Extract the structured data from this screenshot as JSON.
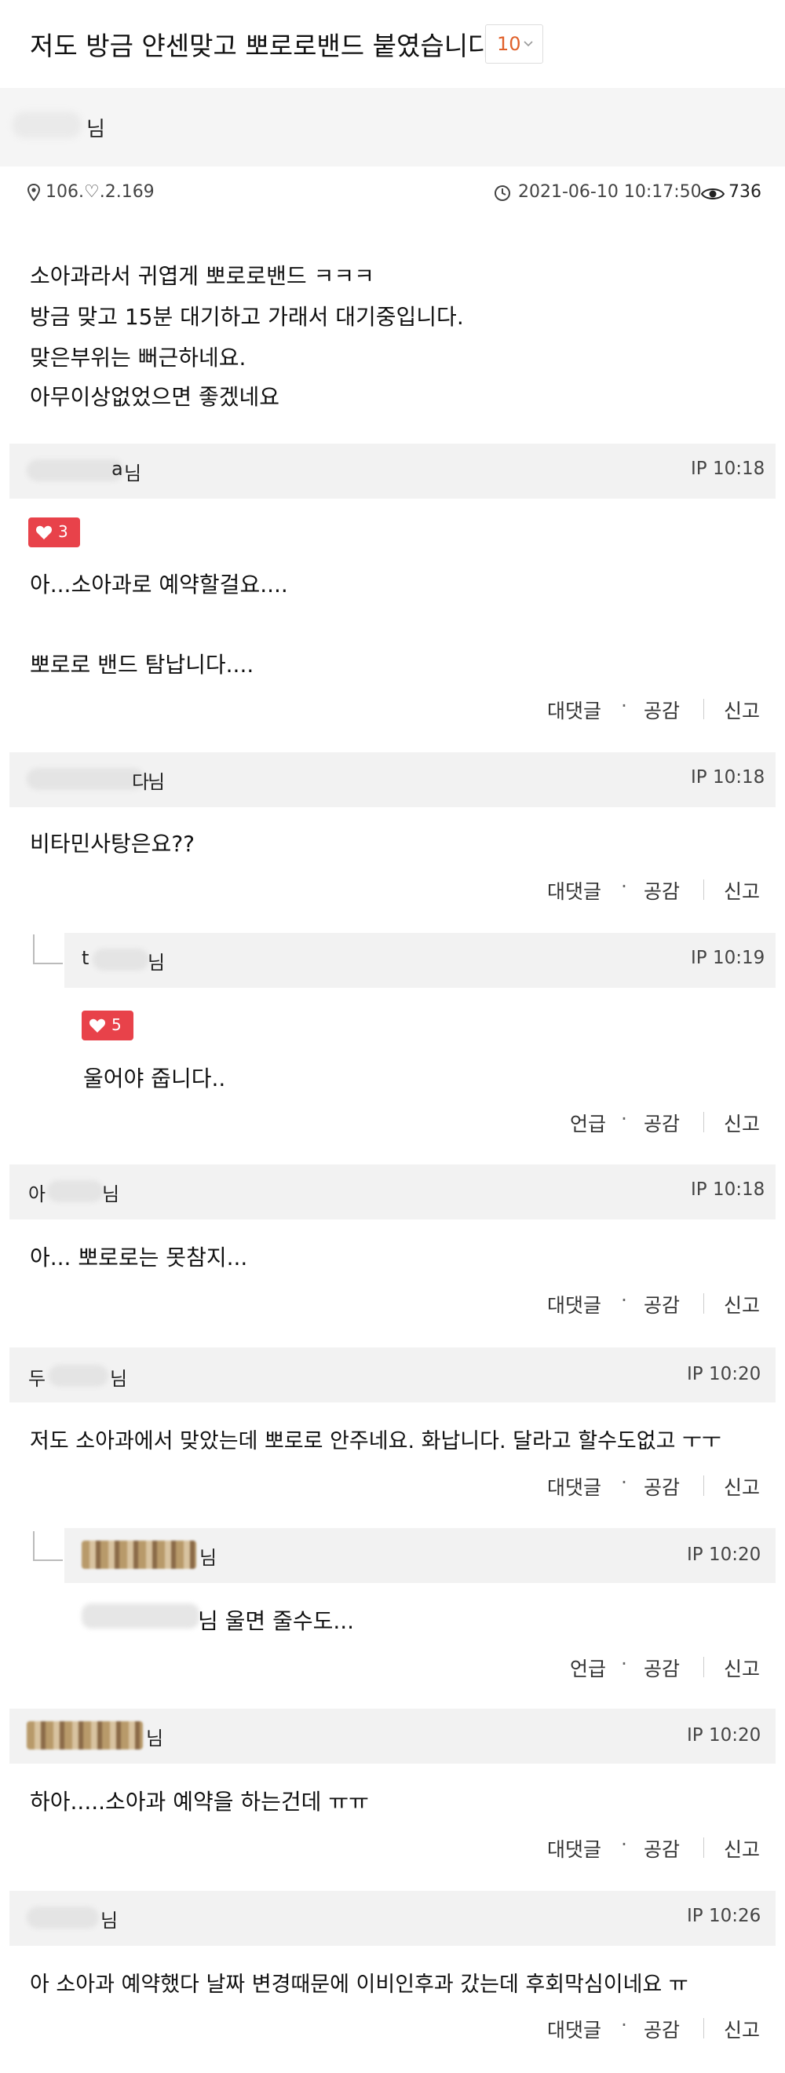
{
  "post": {
    "title": "저도 방금 얀센맞고 뽀로로밴드 붙였습니다.",
    "comment_count": "10",
    "author_suffix": "님",
    "ip": "106.♡.2.169",
    "datetime": "2021-06-10 10:17:50",
    "views": "736",
    "body": [
      "소아과라서 귀엽게 뽀로로밴드 ㅋㅋㅋ",
      "방금 맞고 15분 대기하고 가래서 대기중입니다.",
      "맞은부위는 뻐근하네요.",
      "아무이상없었으면 좋겠네요"
    ]
  },
  "comments": [
    {
      "name_visible": "님",
      "name_frag": "a",
      "time": "IP 10:18",
      "likes": "3",
      "text": [
        "아...소아과로 예약할걸요....",
        "",
        "뽀로로 밴드 탐납니다...."
      ],
      "actions": {
        "reply": "대댓글",
        "like": "공감",
        "report": "신고"
      }
    },
    {
      "name_visible": "님",
      "name_frag": "다",
      "time": "IP 10:18",
      "text": [
        "비타민사탕은요??"
      ],
      "actions": {
        "reply": "대댓글",
        "like": "공감",
        "report": "신고"
      }
    },
    {
      "reply": true,
      "name_visible": "님",
      "name_frag": "t",
      "time": "IP 10:19",
      "likes": "5",
      "text": [
        "울어야 줍니다.."
      ],
      "actions": {
        "reply": "언급",
        "like": "공감",
        "report": "신고"
      }
    },
    {
      "name_visible": "님",
      "name_frag": "아",
      "time": "IP 10:18",
      "text": [
        "아... 뽀로로는 못참지..."
      ],
      "actions": {
        "reply": "대댓글",
        "like": "공감",
        "report": "신고"
      }
    },
    {
      "name_visible": "님",
      "name_frag": "두",
      "time": "IP 10:20",
      "text": [
        "저도 소아과에서 맞았는데 뽀로로 안주네요. 화납니다. 달라고 할수도없고 ㅜㅜ"
      ],
      "actions": {
        "reply": "대댓글",
        "like": "공감",
        "report": "신고"
      }
    },
    {
      "reply": true,
      "name_visible": "님",
      "time": "IP 10:20",
      "text": [
        "님 울면 줄수도..."
      ],
      "actions": {
        "reply": "언급",
        "like": "공감",
        "report": "신고"
      }
    },
    {
      "name_visible": "님",
      "time": "IP 10:20",
      "text": [
        "하아.....소아과 예약을 하는건데 ㅠㅠ"
      ],
      "actions": {
        "reply": "대댓글",
        "like": "공감",
        "report": "신고"
      }
    },
    {
      "name_visible": "님",
      "time": "IP 10:26",
      "text": [
        "아 소아과 예약했다 날짜 변경때문에 이비인후과 갔는데 후회막심이네요 ㅠ"
      ],
      "actions": {
        "reply": "대댓글",
        "like": "공감",
        "report": "신고"
      }
    }
  ],
  "colors": {
    "accent": "#e0602a",
    "like_badge": "#e8424a",
    "header_bg": "#f2f2f2"
  },
  "icons": {
    "location": "pin-icon",
    "time": "clock-icon",
    "views": "eye-icon",
    "like": "heart-icon",
    "dropdown": "chevron-down-icon"
  }
}
